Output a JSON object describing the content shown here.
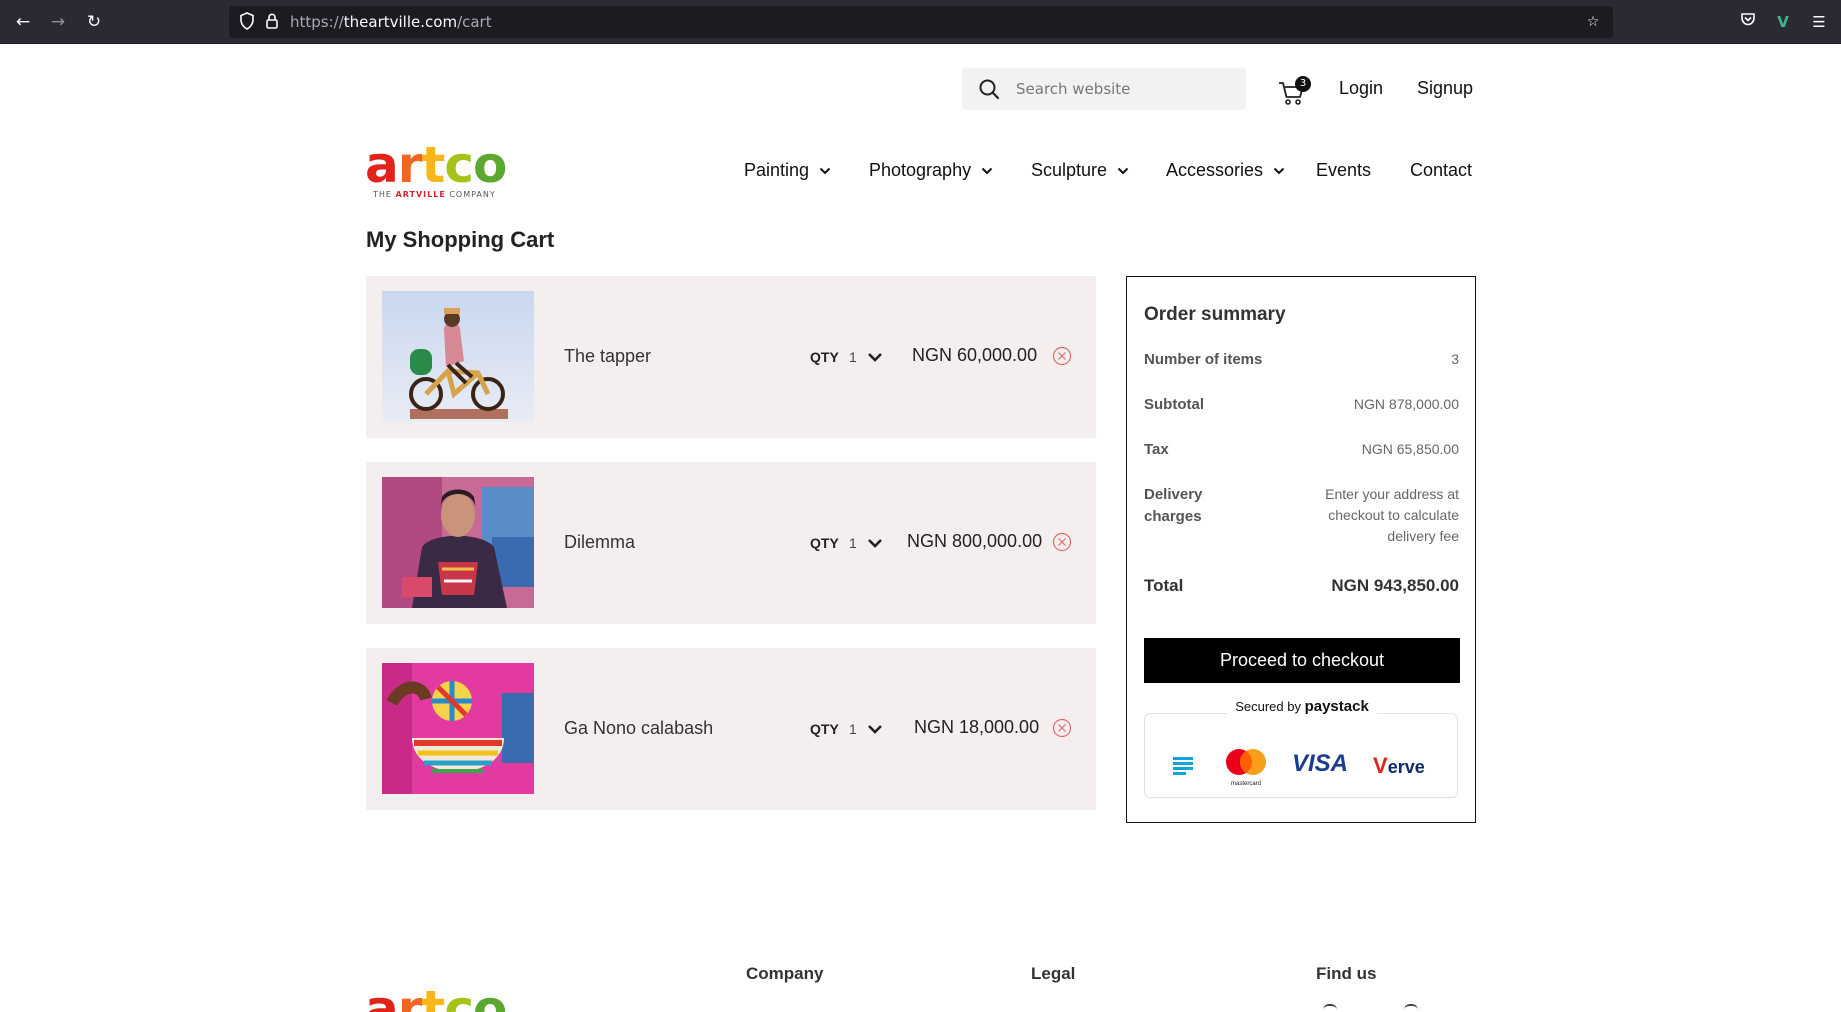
{
  "browser": {
    "url_prefix": "https://",
    "url_domain": "theartville.com",
    "url_path": "/cart"
  },
  "header": {
    "search_placeholder": "Search website",
    "cart_count": "3",
    "login_label": "Login",
    "signup_label": "Signup"
  },
  "logo": {
    "letters": [
      "a",
      "r",
      "t",
      "c",
      "o"
    ],
    "colors": [
      "#e2231a",
      "#f26522",
      "#f7b718",
      "#a5c31b",
      "#5aa82f"
    ],
    "tagline_pre": "THE ",
    "tagline_brand": "ARTVILLE",
    "tagline_post": " COMPANY"
  },
  "nav": {
    "items": [
      {
        "label": "Painting",
        "has_dropdown": true
      },
      {
        "label": "Photography",
        "has_dropdown": true
      },
      {
        "label": "Sculpture",
        "has_dropdown": true
      },
      {
        "label": "Accessories",
        "has_dropdown": true
      },
      {
        "label": "Events",
        "has_dropdown": false
      },
      {
        "label": "Contact",
        "has_dropdown": false
      }
    ]
  },
  "cart": {
    "title": "My Shopping Cart",
    "qty_label": "QTY",
    "items": [
      {
        "name": "The tapper",
        "qty": "1",
        "price": "NGN 60,000.00"
      },
      {
        "name": "Dilemma",
        "qty": "1",
        "price": "NGN 800,000.00"
      },
      {
        "name": "Ga Nono calabash",
        "qty": "1",
        "price": "NGN 18,000.00"
      }
    ]
  },
  "summary": {
    "title": "Order summary",
    "items_label": "Number of items",
    "items_value": "3",
    "subtotal_label": "Subtotal",
    "subtotal_value": "NGN 878,000.00",
    "tax_label": "Tax",
    "tax_value": "NGN 65,850.00",
    "delivery_label_1": "Delivery",
    "delivery_label_2": "charges",
    "delivery_value_1": "Enter your address at",
    "delivery_value_2": "checkout to calculate",
    "delivery_value_3": "delivery fee",
    "total_label": "Total",
    "total_value": "NGN 943,850.00",
    "checkout_label": "Proceed to checkout",
    "secured_by": "Secured by",
    "paystack": "paystack",
    "visa": "VISA",
    "verve": "erve",
    "mastercard": "mastercard"
  },
  "footer": {
    "company_heading": "Company",
    "legal_heading": "Legal",
    "find_us_heading": "Find us"
  }
}
